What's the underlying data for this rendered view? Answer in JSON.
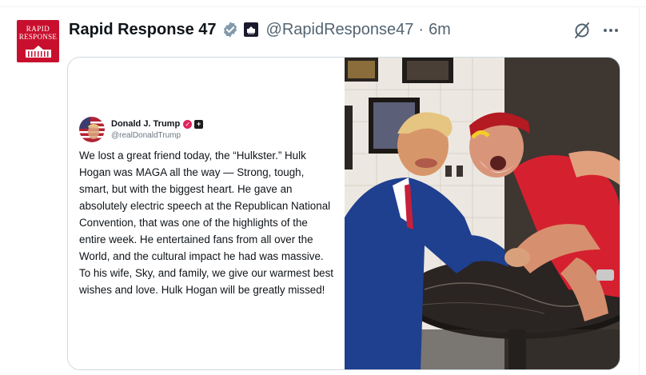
{
  "post": {
    "display_name": "Rapid Response 47",
    "handle": "@RapidResponse47",
    "separator": "·",
    "time": "6m",
    "avatar_line1": "RAPID",
    "avatar_line2": "RESPONSE",
    "icons": {
      "verified": "verified-badge-icon",
      "affiliation": "white-house-affiliate-icon",
      "grok": "grok-icon",
      "more": "more-options-icon"
    },
    "colors": {
      "avatar_bg": "#c8102e",
      "verified": "#829aab",
      "text_secondary": "#536471"
    }
  },
  "quote": {
    "name": "Donald J. Trump",
    "handle": "@realDonaldTrump",
    "text": "We lost a great friend today, the “Hulkster.” Hulk Hogan was MAGA all the way — Strong, tough, smart, but with the biggest heart. He gave an absolutely electric speech at the Republican National Convention, that was one of the highlights of the entire week. He entertained fans from all over the World, and the cultural impact he had was massive. To his wife, Sky, and family, we give our warmest best wishes and love. Hulk Hogan will be greatly missed!",
    "photo": "arm-wrestling-photo"
  }
}
